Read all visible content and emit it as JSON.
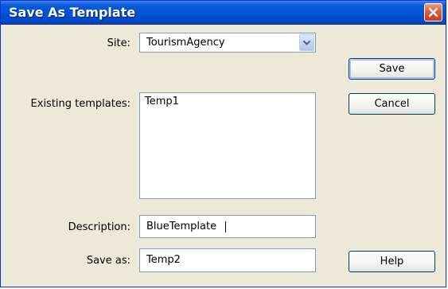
{
  "window": {
    "title": "Save As Template"
  },
  "icons": {
    "close": "close-icon",
    "dropdown": "chevron-down-icon"
  },
  "colors": {
    "titlebar": "#0052d6",
    "close_button": "#e06040",
    "dialog_background": "#ece9d8"
  },
  "form": {
    "site_label": "Site:",
    "site_value": "TourismAgency",
    "existing_templates_label": "Existing templates:",
    "existing_templates": [
      "Temp1"
    ],
    "description_label": "Description:",
    "description_value": "BlueTemplate",
    "save_as_label": "Save as:",
    "save_as_value": "Temp2"
  },
  "buttons": {
    "save": "Save",
    "cancel": "Cancel",
    "help": "Help"
  }
}
